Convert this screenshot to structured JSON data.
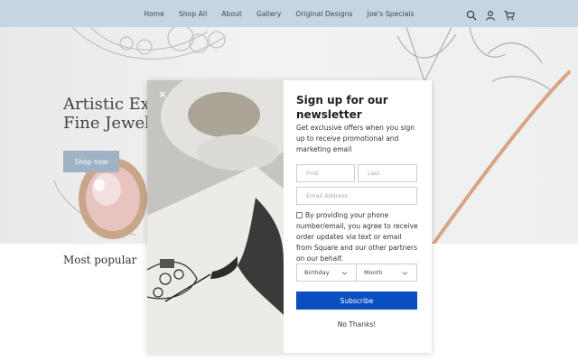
{
  "nav": {
    "links": [
      "Home",
      "Shop All",
      "About",
      "Gallery",
      "Original Designs",
      "Joe's Specials"
    ],
    "icons": [
      "search-icon",
      "account-icon",
      "cart-icon"
    ]
  },
  "hero": {
    "title_line1": "Artistic Exp",
    "title_line2": "Fine Jewelr",
    "cta": "Shop now"
  },
  "section": {
    "heading": "Most popular"
  },
  "modal": {
    "close_label": "×",
    "title": "Sign up for our newsletter",
    "description": "Get exclusive offers when you sign up to receive promotional and marketing email",
    "first_placeholder": "First",
    "last_placeholder": "Last",
    "email_placeholder": "Email Address",
    "consent": "By providing your phone number/email, you agree to receive order updates via text or email from Square and our other partners on our behalf.",
    "birthday_value": "Birthday",
    "month_value": "Month",
    "subscribe": "Subscribe",
    "no_thanks": "No Thanks!"
  },
  "colors": {
    "nav_bg": "#c7d5e3",
    "accent": "#0a4fc0",
    "hero_button": "#9fb2c6"
  }
}
